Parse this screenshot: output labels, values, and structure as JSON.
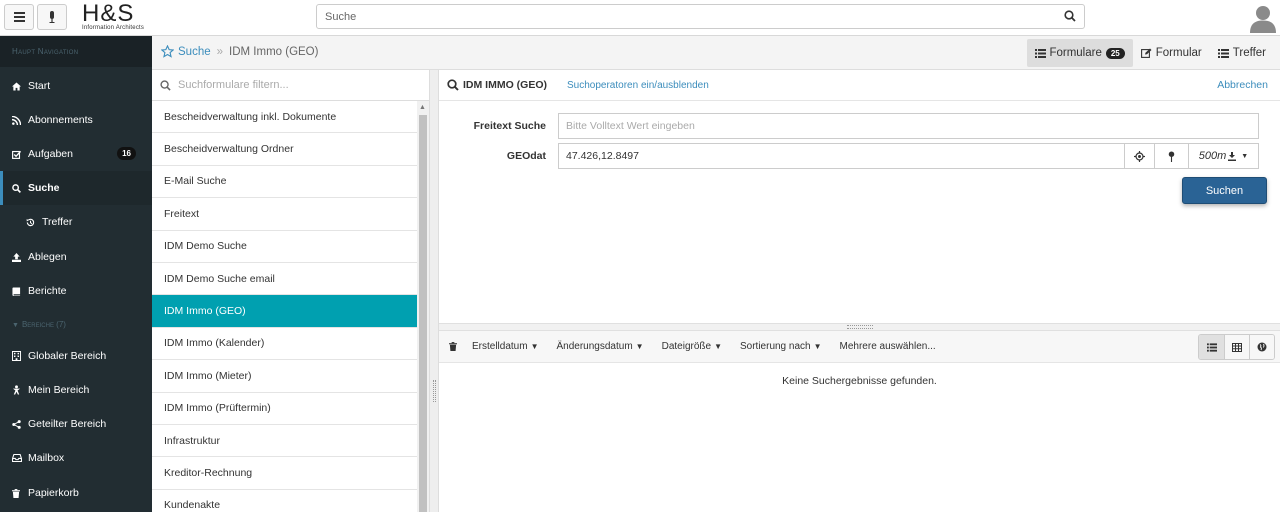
{
  "topbar": {
    "menu_icon": "hamburger-icon",
    "mic_icon": "microphone-icon",
    "logo_main": "H&S",
    "logo_sub": "Information Architects",
    "search_placeholder": "Suche",
    "search_icon": "search-icon",
    "avatar_icon": "user-avatar-icon"
  },
  "sidebar": {
    "header": "Haupt Navigation",
    "items": [
      {
        "label": "Start",
        "icon": "home-icon"
      },
      {
        "label": "Abonnements",
        "icon": "rss-icon"
      },
      {
        "label": "Aufgaben",
        "icon": "checkbox-icon",
        "badge": "16"
      },
      {
        "label": "Suche",
        "icon": "search-icon",
        "active": true
      },
      {
        "label": "Treffer",
        "icon": "history-icon"
      },
      {
        "label": "Ablegen",
        "icon": "upload-icon"
      },
      {
        "label": "Berichte",
        "icon": "book-icon"
      }
    ],
    "section_label": "Bereiche (7)",
    "areas": [
      {
        "label": "Globaler Bereich",
        "icon": "building-icon"
      },
      {
        "label": "Mein Bereich",
        "icon": "user-icon"
      },
      {
        "label": "Geteilter Bereich",
        "icon": "share-icon"
      },
      {
        "label": "Mailbox",
        "icon": "inbox-icon"
      },
      {
        "label": "Papierkorb",
        "icon": "trash-icon"
      }
    ]
  },
  "breadcrumb": {
    "root": "Suche",
    "separator": "»",
    "current": "IDM Immo (GEO)"
  },
  "view_buttons": {
    "formulare": "Formulare",
    "formulare_count": "25",
    "formular": "Formular",
    "treffer": "Treffer"
  },
  "form_list": {
    "filter_placeholder": "Suchformulare filtern...",
    "items": [
      "Bescheidverwaltung inkl. Dokumente",
      "Bescheidverwaltung Ordner",
      "E-Mail Suche",
      "Freitext",
      "IDM Demo Suche",
      "IDM Demo Suche email",
      "IDM Immo (GEO)",
      "IDM Immo (Kalender)",
      "IDM Immo (Mieter)",
      "IDM Immo (Prüftermin)",
      "Infrastruktur",
      "Kreditor-Rechnung",
      "Kundenakte"
    ],
    "active_index": 6
  },
  "search_form": {
    "title": "IDM IMMO (GEO)",
    "toggle_operators": "Suchoperatoren ein/ausblenden",
    "cancel": "Abbrechen",
    "fulltext_label": "Freitext Suche",
    "fulltext_placeholder": "Bitte Volltext Wert eingeben",
    "geo_label": "GEOdat",
    "geo_value": "47.426,12.8497",
    "radius": "500m",
    "submit": "Suchen"
  },
  "results": {
    "toolbar": [
      "Erstelldatum",
      "Änderungsdatum",
      "Dateigröße",
      "Sortierung nach"
    ],
    "multi_select": "Mehrere auswählen...",
    "empty_message": "Keine Suchergebnisse gefunden."
  },
  "colors": {
    "sidebar_bg": "#222d32",
    "accent_link": "#3c8dbc",
    "active_form": "#00a0b0",
    "primary_button": "#2a6395"
  }
}
